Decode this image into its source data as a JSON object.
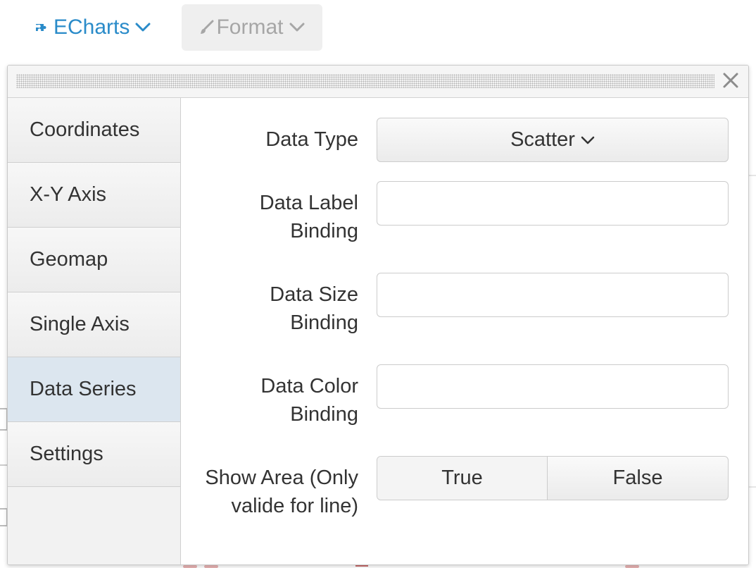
{
  "toolbar": {
    "echarts": {
      "label": "ECharts",
      "icon": "puzzle-icon",
      "color": "#2a8bc9"
    },
    "format": {
      "label": "Format",
      "icon": "brush-icon"
    }
  },
  "dialog": {
    "close_icon": "close-icon",
    "sidebar": {
      "items": [
        {
          "label": "Coordinates"
        },
        {
          "label": "X-Y Axis"
        },
        {
          "label": "Geomap"
        },
        {
          "label": "Single Axis"
        },
        {
          "label": "Data Series",
          "active": true
        },
        {
          "label": "Settings"
        }
      ]
    },
    "form": {
      "data_type": {
        "label": "Data Type",
        "value": "Scatter"
      },
      "data_label_binding": {
        "label": "Data Label\nBinding",
        "value": ""
      },
      "data_size_binding": {
        "label": "Data Size\nBinding",
        "value": ""
      },
      "data_color_binding": {
        "label": "Data Color\nBinding",
        "value": ""
      },
      "show_area": {
        "label": "Show Area (Only\nvalide for line)",
        "options": [
          "True",
          "False"
        ]
      }
    },
    "colors": {
      "active_tab": "#dce6ef",
      "accent": "#2a8bc9"
    }
  }
}
